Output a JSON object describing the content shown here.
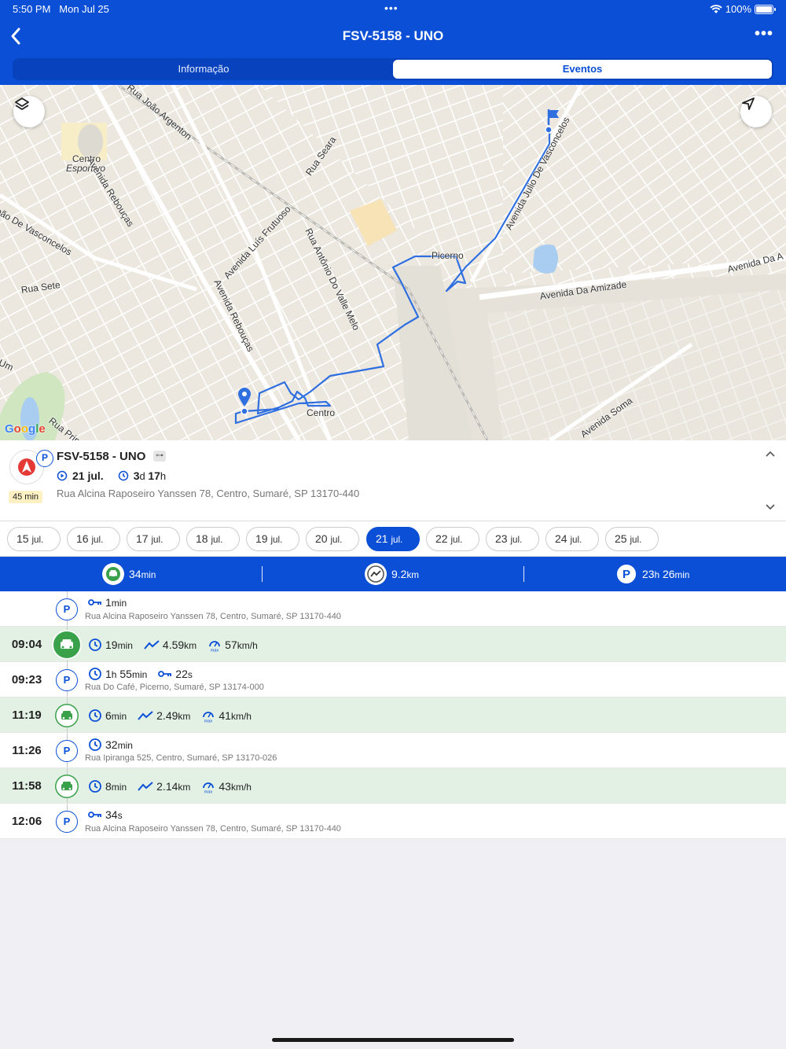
{
  "status_bar": {
    "time": "5:50 PM",
    "date": "Mon Jul 25",
    "battery": "100%"
  },
  "nav": {
    "title": "FSV-5158 - UNO"
  },
  "tabs": [
    {
      "label": "Informação",
      "active": false
    },
    {
      "label": "Eventos",
      "active": true
    }
  ],
  "map": {
    "labels": {
      "l1": "Centro",
      "l2": "Esportivo",
      "l3": "Avenida Rebouças",
      "l4": "Rua João Argenton",
      "l5": "Rua Seara",
      "l6": "Avenida Julio De Vasconcelos",
      "l7": "João De Vasconcelos",
      "l8": "Rua Sete",
      "l9": "Avenida Luís Frutuoso",
      "l10": "Rua Antônio Do Valle Melo",
      "l11": "Avenida Rebouças",
      "l12": "Picerno",
      "l13": "Avenida Da Amizade",
      "l14": "Avenida Da A",
      "l15": "Centro",
      "l16": "Avenida Soma",
      "l17": "Um",
      "l18": "Rua Prim"
    },
    "attribution": "Google"
  },
  "vehicle_card": {
    "name": "FSV-5158 - UNO",
    "badge": "P",
    "duration": "45 min",
    "date": "21 jul.",
    "elapsed_value": "3",
    "elapsed_unit": "d",
    "elapsed_value2": "17",
    "elapsed_unit2": "h",
    "address": "Rua Alcina Raposeiro Yanssen 78, Centro, Sumaré, SP 13170-440"
  },
  "dates": [
    {
      "day": "15",
      "month": "jul.",
      "active": false
    },
    {
      "day": "16",
      "month": "jul.",
      "active": false
    },
    {
      "day": "17",
      "month": "jul.",
      "active": false
    },
    {
      "day": "18",
      "month": "jul.",
      "active": false
    },
    {
      "day": "19",
      "month": "jul.",
      "active": false
    },
    {
      "day": "20",
      "month": "jul.",
      "active": false
    },
    {
      "day": "21",
      "month": "jul.",
      "active": true
    },
    {
      "day": "22",
      "month": "jul.",
      "active": false
    },
    {
      "day": "23",
      "month": "jul.",
      "active": false
    },
    {
      "day": "24",
      "month": "jul.",
      "active": false
    },
    {
      "day": "25",
      "month": "jul.",
      "active": false
    }
  ],
  "summary": {
    "driving": {
      "value": "34",
      "unit": "min"
    },
    "distance": {
      "value": "9.2",
      "unit": "km"
    },
    "parked": {
      "value1": "23",
      "unit1": "h",
      "value2": "26",
      "unit2": "min"
    }
  },
  "events": [
    {
      "type": "parked",
      "time": "",
      "idle": {
        "v": "1",
        "u": "min"
      },
      "address": "Rua Alcina Raposeiro Yanssen 78, Centro, Sumaré, SP 13170-440"
    },
    {
      "type": "drive",
      "time": "09:04",
      "dur": {
        "v": "19",
        "u": "min"
      },
      "dist": {
        "v": "4.59",
        "u": "km"
      },
      "speed": {
        "v": "57",
        "u": "km/h"
      },
      "speed_tag": "max"
    },
    {
      "type": "parked",
      "time": "09:23",
      "dur": {
        "v1": "1",
        "u1": "h",
        "v2": "55",
        "u2": "min"
      },
      "idle": {
        "v": "22",
        "u": "s"
      },
      "address": "Rua Do Café, Picerno, Sumaré, SP 13174-000"
    },
    {
      "type": "drive",
      "time": "11:19",
      "dur": {
        "v": "6",
        "u": "min"
      },
      "dist": {
        "v": "2.49",
        "u": "km"
      },
      "speed": {
        "v": "41",
        "u": "km/h"
      },
      "speed_tag": "max"
    },
    {
      "type": "parked",
      "time": "11:26",
      "dur": {
        "v": "32",
        "u": "min"
      },
      "address": "Rua Ipiranga 525, Centro, Sumaré, SP 13170-026"
    },
    {
      "type": "drive",
      "time": "11:58",
      "dur": {
        "v": "8",
        "u": "min"
      },
      "dist": {
        "v": "2.14",
        "u": "km"
      },
      "speed": {
        "v": "43",
        "u": "km/h"
      },
      "speed_tag": "max"
    },
    {
      "type": "parked",
      "time": "12:06",
      "idle": {
        "v": "34",
        "u": "s"
      },
      "address": "Rua Alcina Raposeiro Yanssen 78, Centro, Sumaré, SP 13170-440"
    }
  ],
  "colors": {
    "brand": "#0a4fd6",
    "drive": "#3aa14b",
    "drive_row": "#e3f1e5",
    "route": "#2f6fe0"
  },
  "icons": {
    "back": "chevron-left-icon",
    "more": "ellipsis-icon",
    "layers": "layers-icon",
    "locate": "navigation-arrow-icon",
    "clock": "clock-icon",
    "distance": "trend-line-icon",
    "speed": "speedometer-icon",
    "key": "key-icon",
    "car": "car-icon",
    "parking": "parking-icon"
  }
}
